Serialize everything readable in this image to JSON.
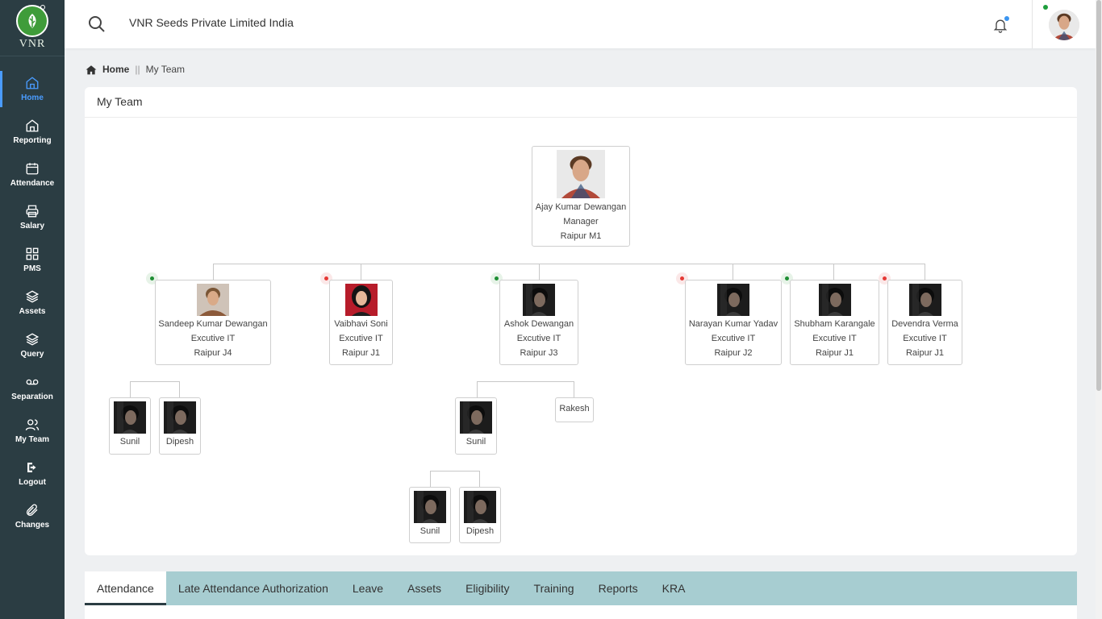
{
  "brand": {
    "logo_text": "VNR"
  },
  "company_name": "VNR Seeds Private Limited India",
  "nav": [
    {
      "label": "Home",
      "icon": "home-icon"
    },
    {
      "label": "Reporting",
      "icon": "home-icon"
    },
    {
      "label": "Attendance",
      "icon": "calendar-icon"
    },
    {
      "label": "Salary",
      "icon": "printer-icon"
    },
    {
      "label": "PMS",
      "icon": "grid-icon"
    },
    {
      "label": "Assets",
      "icon": "layers-icon"
    },
    {
      "label": "Query",
      "icon": "layers-icon"
    },
    {
      "label": "Separation",
      "icon": "voicemail-icon"
    },
    {
      "label": "My Team",
      "icon": "users-icon"
    },
    {
      "label": "Logout",
      "icon": "logout-icon"
    },
    {
      "label": "Changes",
      "icon": "paperclip-icon"
    }
  ],
  "breadcrumb": {
    "home": "Home",
    "separator": "||",
    "current": "My Team"
  },
  "card_title": "My Team",
  "tree": {
    "manager": {
      "name": "Ajay Kumar Dewangan",
      "role": "Manager",
      "location": "Raipur M1"
    },
    "reports": [
      {
        "name": "Sandeep Kumar Dewangan",
        "role": "Excutive IT",
        "location": "Raipur J4",
        "status": "green"
      },
      {
        "name": "Vaibhavi Soni",
        "role": "Excutive IT",
        "location": "Raipur J1",
        "status": "red"
      },
      {
        "name": "Ashok Dewangan",
        "role": "Excutive IT",
        "location": "Raipur J3",
        "status": "green"
      },
      {
        "name": "Narayan Kumar Yadav",
        "role": "Excutive IT",
        "location": "Raipur J2",
        "status": "red"
      },
      {
        "name": "Shubham Karangale",
        "role": "Excutive IT",
        "location": "Raipur J1",
        "status": "green"
      },
      {
        "name": "Devendra Verma",
        "role": "Excutive IT",
        "location": "Raipur J1",
        "status": "red"
      }
    ],
    "sandeep_team": [
      "Sunil",
      "Dipesh"
    ],
    "ashok_team": [
      "Sunil",
      "Rakesh"
    ],
    "sunil_team": [
      "Sunil",
      "Dipesh"
    ]
  },
  "tabs": [
    "Attendance",
    "Late Attendance Authorization",
    "Leave",
    "Assets",
    "Eligibility",
    "Training",
    "Reports",
    "KRA"
  ],
  "colors": {
    "sidebar": "#2b3d43",
    "active": "#4a9cff",
    "tabs_bg": "#a7cdd1",
    "online": "#1e8e34",
    "offline": "#e53935"
  }
}
